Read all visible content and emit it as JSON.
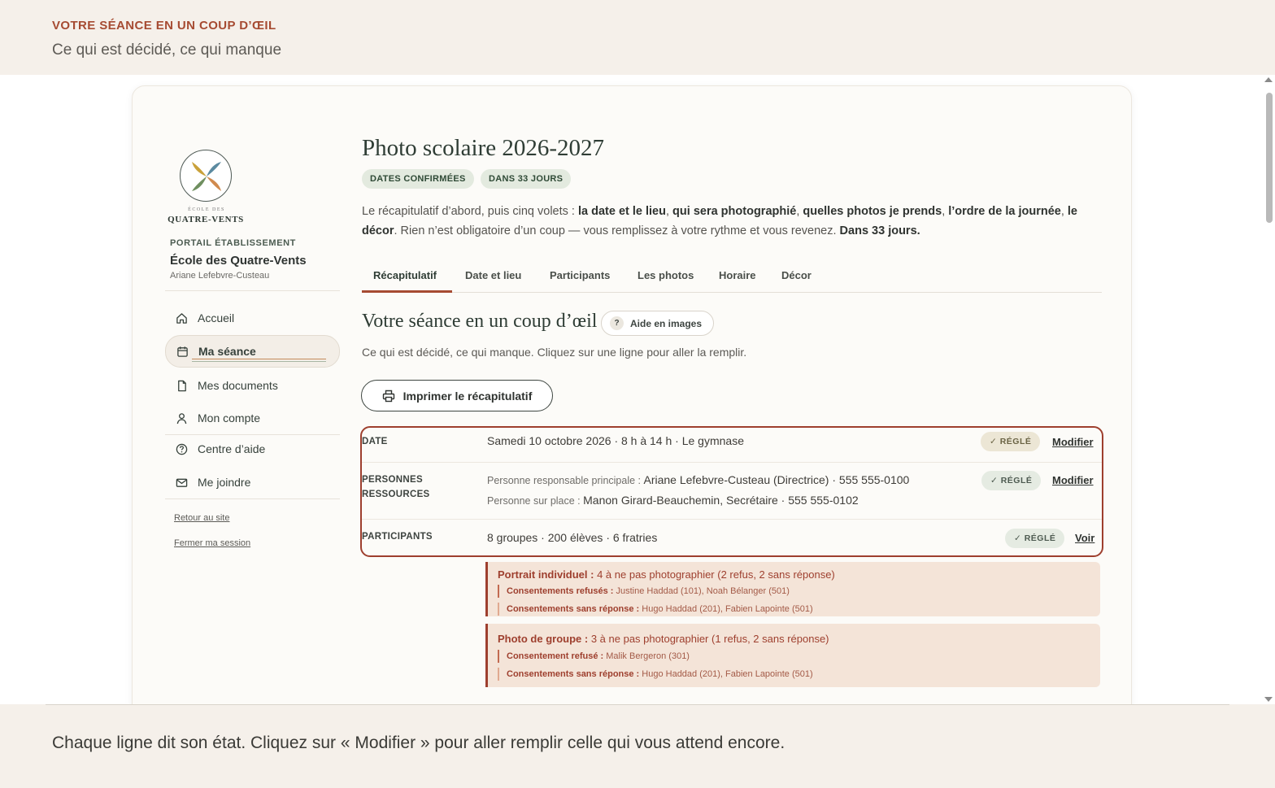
{
  "header": {
    "kicker": "VOTRE SÉANCE EN UN COUP D’ŒIL",
    "subtitle": "Ce qui est décidé, ce qui manque"
  },
  "footer": {
    "caption": "Chaque ligne dit son état. Cliquez sur « Modifier » pour aller remplir celle qui vous attend encore."
  },
  "sidebar": {
    "logo_small": "ÉCOLE DES",
    "logo_name": "QUATRE-VENTS",
    "portal_label": "PORTAIL ÉTABLISSEMENT",
    "school_name": "École des Quatre-Vents",
    "user_name": "Ariane Lefebvre-Custeau",
    "items": [
      {
        "label": "Accueil",
        "icon": "home-icon"
      },
      {
        "label": "Ma séance",
        "icon": "calendar-icon",
        "active": true
      },
      {
        "label": "Mes documents",
        "icon": "document-icon"
      },
      {
        "label": "Mon compte",
        "icon": "user-icon"
      },
      {
        "label": "Centre d’aide",
        "icon": "help-icon"
      },
      {
        "label": "Me joindre",
        "icon": "mail-icon"
      }
    ],
    "links": [
      "Retour au site",
      "Fermer ma session"
    ]
  },
  "main": {
    "title": "Photo scolaire 2026-2027",
    "badges": [
      "DATES CONFIRMÉES",
      "DANS 33 JOURS"
    ],
    "intro": {
      "p1": "Le récapitulatif d’abord, puis cinq volets : ",
      "b1": "la date et le lieu",
      "p2": ", ",
      "b2": "qui sera photographié",
      "p3": ", ",
      "b3": "quelles photos je prends",
      "p4": ", ",
      "b4": "l’ordre de la journée",
      "p5": ", ",
      "b5": "le décor",
      "p6": ". Rien n’est obligatoire d’un coup — vous remplissez à votre rythme et vous revenez. ",
      "b6": "Dans 33 jours."
    },
    "tabs": [
      "Récapitulatif",
      "Date et lieu",
      "Participants",
      "Les photos",
      "Horaire",
      "Décor"
    ],
    "active_tab": "Récapitulatif",
    "section_title": "Votre séance en un coup d’œil",
    "help_label": "Aide en images",
    "section_sub": "Ce qui est décidé, ce qui manque. Cliquez sur une ligne pour aller la remplir.",
    "print_label": "Imprimer le récapitulatif",
    "rows": {
      "date": {
        "label": "DATE",
        "value": "Samedi 10 octobre 2026 · 8 h à 14 h · Le gymnase",
        "status": "✓ RÉGLÉ",
        "action": "Modifier"
      },
      "people": {
        "label_line1": "PERSONNES",
        "label_line2": "RESSOURCES",
        "line1_prefix": "Personne responsable principale : ",
        "line1_value": "Ariane Lefebvre-Custeau (Directrice) · 555 555-0100",
        "line2_prefix": "Personne sur place : ",
        "line2_value": "Manon Girard-Beauchemin, Secrétaire · 555 555-0102",
        "status": "✓ RÉGLÉ",
        "action": "Modifier"
      },
      "participants": {
        "label": "PARTICIPANTS",
        "value": "8 groupes · 200 élèves · 6 fratries",
        "status": "✓ RÉGLÉ",
        "action": "Voir"
      }
    },
    "alerts": [
      {
        "head_bold": "Portrait individuel :",
        "head_text": " 4 à ne pas photographier (2 refus, 2 sans réponse)",
        "lines": [
          {
            "bold": "Consentements refusés :",
            "text": " Justine Haddad (101), Noah Bélanger (501)"
          },
          {
            "bold": "Consentements sans réponse :",
            "text": " Hugo Haddad (201), Fabien Lapointe (501)"
          }
        ]
      },
      {
        "head_bold": "Photo de groupe :",
        "head_text": " 3 à ne pas photographier (1 refus, 2 sans réponse)",
        "lines": [
          {
            "bold": "Consentement refusé :",
            "text": " Malik Bergeron (301)"
          },
          {
            "bold": "Consentements sans réponse :",
            "text": " Hugo Haddad (201), Fabien Lapointe (501)"
          }
        ]
      }
    ]
  },
  "colors": {
    "accent": "#a64b32",
    "frame": "#9e3f2e",
    "badge_bg": "#e3eadf",
    "alert_bg": "#f4e4d8"
  }
}
